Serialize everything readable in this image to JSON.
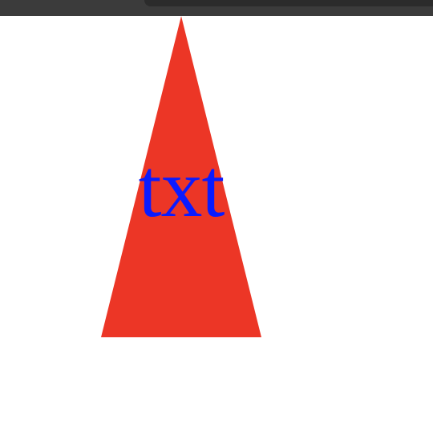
{
  "shape": {
    "type": "triangle",
    "fill_color": "#EC3626",
    "text": "txt",
    "text_color": "#0A1BFF"
  }
}
